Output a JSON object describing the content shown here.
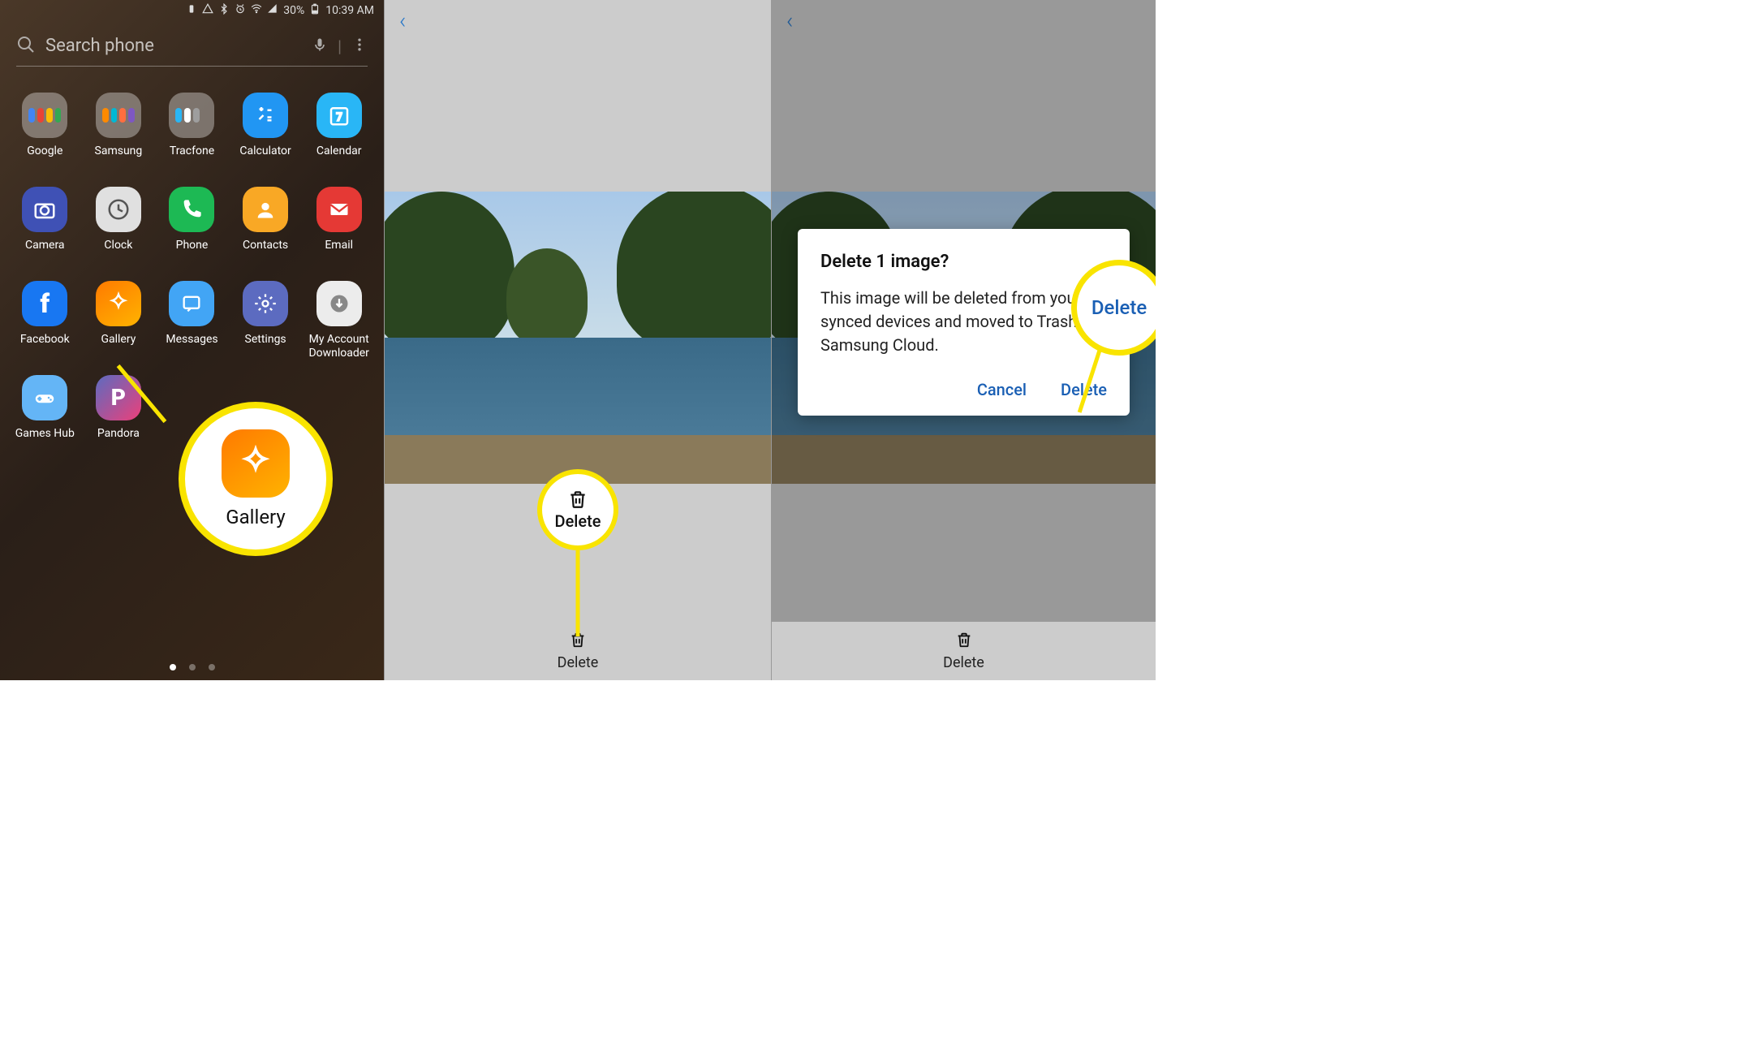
{
  "panel1": {
    "status": {
      "battery_pct": "30%",
      "time": "10:39 AM"
    },
    "search_placeholder": "Search phone",
    "apps": [
      {
        "name": "Google",
        "folder": true
      },
      {
        "name": "Samsung",
        "folder": true
      },
      {
        "name": "Tracfone",
        "folder": true
      },
      {
        "name": "Calculator",
        "bg": "#2196f3"
      },
      {
        "name": "Calendar",
        "bg": "#29b6f6"
      },
      {
        "name": "Camera",
        "bg": "#3f51b5"
      },
      {
        "name": "Clock",
        "bg": "#e0e0e0"
      },
      {
        "name": "Phone",
        "bg": "#1db954"
      },
      {
        "name": "Contacts",
        "bg": "#f9a825"
      },
      {
        "name": "Email",
        "bg": "#e53935"
      },
      {
        "name": "Facebook",
        "bg": "#1877f2"
      },
      {
        "name": "Gallery",
        "bg": "linear-gradient(145deg,#ff7a00,#ffb300)"
      },
      {
        "name": "Messages",
        "bg": "#42a5f5"
      },
      {
        "name": "Settings",
        "bg": "#5c6bc0"
      },
      {
        "name": "My Account Downloader",
        "bg": "#ececec"
      },
      {
        "name": "Games Hub",
        "bg": "#64b5f6"
      },
      {
        "name": "Pandora",
        "bg": "#3f51b5"
      }
    ],
    "callout_label": "Gallery"
  },
  "panel2": {
    "delete_callout": "Delete",
    "bottom_label": "Delete"
  },
  "panel3": {
    "dialog": {
      "title": "Delete 1 image?",
      "body": "This image will be deleted from your synced devices and moved to Trash in Samsung Cloud.",
      "cancel": "Cancel",
      "confirm": "Delete"
    },
    "callout_label": "Delete",
    "bottom_label": "Delete"
  }
}
